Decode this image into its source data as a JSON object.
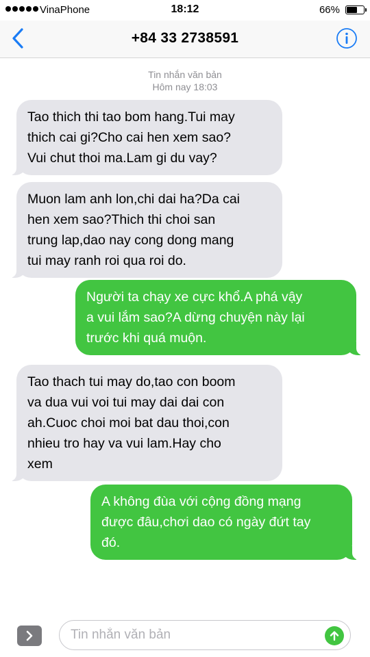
{
  "status_bar": {
    "carrier": "VinaPhone",
    "time": "18:12",
    "battery_percent": "66%",
    "battery_level": 0.66,
    "signal_bars": 5
  },
  "nav": {
    "title": "+84 33 2738591",
    "back_icon": "chevron-left-icon",
    "info_icon": "info-circle-icon"
  },
  "thread": {
    "message_type": "Tin nhắn văn bản",
    "timestamp": "Hôm nay 18:03",
    "messages": [
      {
        "direction": "incoming",
        "text": "Tao thich thi tao bom hang.Tui may\nthich cai gi?Cho cai hen xem sao?\nVui chut thoi ma.Lam gi du vay?"
      },
      {
        "direction": "incoming",
        "text": "Muon lam anh lon,chi dai ha?Da cai\nhen xem sao?Thich thi choi san\ntrung lap,dao nay cong dong mang\ntui may ranh roi qua roi do."
      },
      {
        "direction": "outgoing",
        "text": "Người ta chạy xe cực khổ.A phá vậy\na vui lắm sao?A dừng chuyện này lại\ntrước khi quá muộn."
      },
      {
        "direction": "incoming",
        "text": "Tao thach tui may do,tao con boom\nva dua vui voi tui may dai dai con\nah.Cuoc choi moi bat dau thoi,con\nnhieu tro hay va vui lam.Hay cho\nxem"
      },
      {
        "direction": "outgoing",
        "text": "A không đùa với cộng đồng mạng\nđược đâu,chơi dao có ngày đứt tay\nđó."
      }
    ]
  },
  "composer": {
    "placeholder": "Tin nhắn văn bản",
    "value": "",
    "expand_icon": "chevron-right-icon",
    "send_icon": "arrow-up-icon"
  },
  "colors": {
    "incoming_bubble": "#e5e5ea",
    "outgoing_bubble": "#42c541",
    "accent": "#1a7cf5",
    "meta_text": "#8e8e93"
  }
}
